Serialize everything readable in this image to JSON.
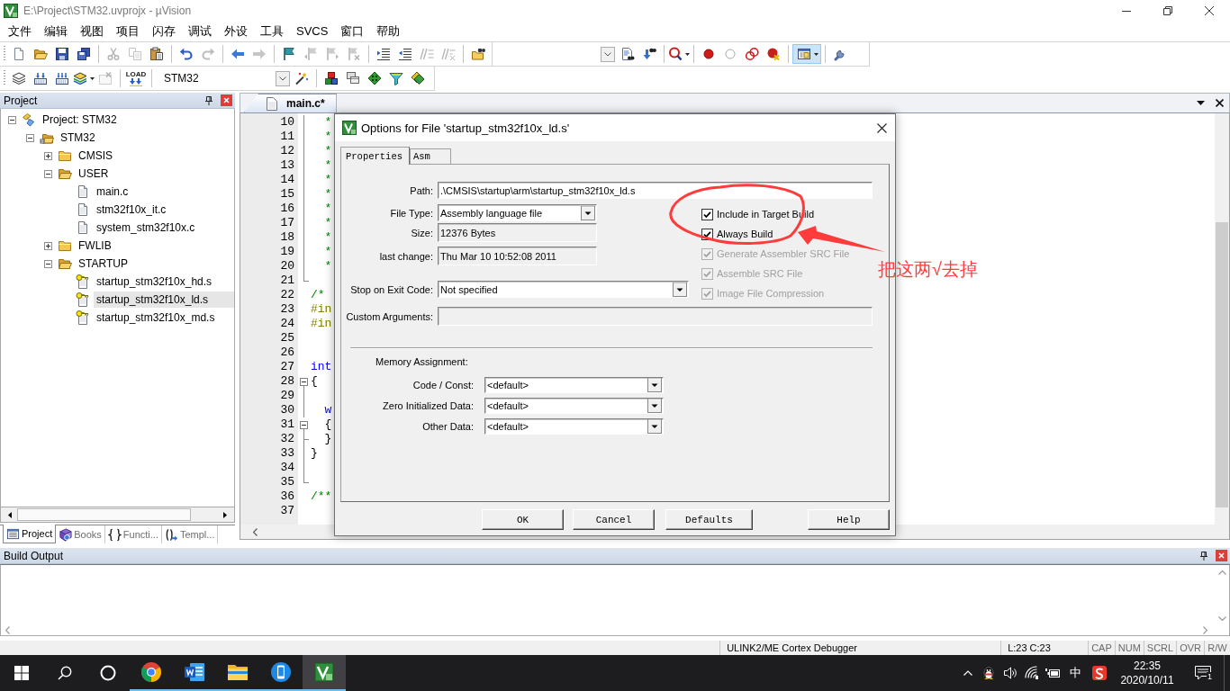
{
  "window": {
    "title": "E:\\Project\\STM32.uvprojx - µVision"
  },
  "menu": [
    "文件",
    "编辑",
    "视图",
    "项目",
    "闪存",
    "调试",
    "外设",
    "工具",
    "SVCS",
    "窗口",
    "帮助"
  ],
  "edit_toolbar": {
    "groups": [
      [
        {
          "kind": "new-file",
          "disabled": false
        },
        {
          "kind": "open",
          "disabled": false
        },
        {
          "kind": "save",
          "disabled": false
        },
        {
          "kind": "save-all",
          "disabled": false
        }
      ],
      [
        {
          "kind": "cut",
          "disabled": true
        },
        {
          "kind": "copy",
          "disabled": true
        },
        {
          "kind": "paste",
          "disabled": false
        }
      ],
      [
        {
          "kind": "undo",
          "disabled": false
        },
        {
          "kind": "redo",
          "disabled": true
        }
      ],
      [
        {
          "kind": "back",
          "disabled": false
        },
        {
          "kind": "forward",
          "disabled": true
        }
      ],
      [
        {
          "kind": "bookmark",
          "disabled": false
        },
        {
          "kind": "bookmark-prev",
          "disabled": true
        },
        {
          "kind": "bookmark-next",
          "disabled": true
        },
        {
          "kind": "bookmark-clear",
          "disabled": true
        }
      ],
      [
        {
          "kind": "indent",
          "disabled": false
        },
        {
          "kind": "unindent",
          "disabled": false
        },
        {
          "kind": "comment",
          "disabled": true
        },
        {
          "kind": "uncomment",
          "disabled": true
        }
      ],
      [
        {
          "kind": "find-files",
          "disabled": false
        }
      ]
    ]
  },
  "find_toolbar": {
    "groups": [
      [
        {
          "kind": "find-doc",
          "disabled": false
        },
        {
          "kind": "find-incremental",
          "disabled": false
        }
      ],
      [
        {
          "kind": "debug",
          "disabled": false,
          "menu": true
        }
      ],
      [
        {
          "kind": "breakpoint",
          "disabled": false
        },
        {
          "kind": "breakpoint-off",
          "disabled": false
        },
        {
          "kind": "breakpoint-toggle",
          "disabled": false
        },
        {
          "kind": "breakpoint-kill",
          "disabled": false
        }
      ],
      [
        {
          "kind": "window-layout",
          "disabled": false,
          "menu": true,
          "pressed": true
        }
      ],
      [
        {
          "kind": "configure",
          "disabled": false
        }
      ]
    ]
  },
  "build_toolbar": {
    "groups": [
      [
        {
          "kind": "translate",
          "disabled": false,
          "menu": false
        },
        {
          "kind": "build",
          "disabled": false,
          "menu": false
        },
        {
          "kind": "rebuild",
          "disabled": false,
          "menu": false
        },
        {
          "kind": "batch-build",
          "disabled": false,
          "menu": true
        },
        {
          "kind": "stop",
          "disabled": true,
          "menu": false
        }
      ],
      [
        {
          "kind": "download",
          "disabled": false,
          "label": "LOAD"
        }
      ]
    ],
    "target": "STM32",
    "target_groups": [
      [
        {
          "kind": "target-options",
          "disabled": false
        }
      ],
      [
        {
          "kind": "components",
          "disabled": false
        },
        {
          "kind": "windows",
          "disabled": false
        },
        {
          "kind": "diamond",
          "disabled": false
        },
        {
          "kind": "funnel",
          "disabled": false
        },
        {
          "kind": "diamonds",
          "disabled": false
        }
      ]
    ]
  },
  "project_panel": {
    "title": "Project",
    "tree": [
      {
        "label": "Project: STM32",
        "kind": "project",
        "expanded": true,
        "selected": false,
        "children": [
          {
            "label": "STM32",
            "kind": "target",
            "expanded": true,
            "selected": false,
            "children": [
              {
                "label": "CMSIS",
                "kind": "group",
                "expanded": false,
                "selected": false
              },
              {
                "label": "USER",
                "kind": "group",
                "expanded": true,
                "selected": false,
                "children": [
                  {
                    "label": "main.c",
                    "kind": "file",
                    "has_options": false,
                    "selected": false
                  },
                  {
                    "label": "stm32f10x_it.c",
                    "kind": "file",
                    "has_options": false,
                    "selected": false
                  },
                  {
                    "label": "system_stm32f10x.c",
                    "kind": "file",
                    "has_options": false,
                    "selected": false
                  }
                ]
              },
              {
                "label": "FWLIB",
                "kind": "group",
                "expanded": false,
                "selected": false
              },
              {
                "label": "STARTUP",
                "kind": "group",
                "expanded": true,
                "selected": false,
                "children": [
                  {
                    "label": "startup_stm32f10x_hd.s",
                    "kind": "file",
                    "has_options": true,
                    "selected": false
                  },
                  {
                    "label": "startup_stm32f10x_ld.s",
                    "kind": "file",
                    "has_options": true,
                    "selected": true
                  },
                  {
                    "label": "startup_stm32f10x_md.s",
                    "kind": "file",
                    "has_options": true,
                    "selected": false
                  }
                ]
              }
            ]
          }
        ]
      }
    ],
    "tabs": [
      {
        "label": "Project",
        "kind": "project",
        "selected": true
      },
      {
        "label": "Books",
        "kind": "books",
        "selected": false
      },
      {
        "label": "Functi...",
        "kind": "functions",
        "selected": false
      },
      {
        "label": "Templ...",
        "kind": "templates",
        "selected": false
      }
    ]
  },
  "editor": {
    "tabs": [
      {
        "label": "main.c*",
        "selected": true
      }
    ],
    "lines": [
      {
        "number": "10",
        "kind": "comment",
        "text": "  *",
        "fold": {
          "kind": "line"
        }
      },
      {
        "number": "11",
        "kind": "comment",
        "text": "  *",
        "fold": {
          "kind": "line"
        }
      },
      {
        "number": "12",
        "kind": "comment",
        "text": "  *",
        "fold": {
          "kind": "line"
        }
      },
      {
        "number": "13",
        "kind": "comment",
        "text": "  *",
        "fold": {
          "kind": "line"
        }
      },
      {
        "number": "14",
        "kind": "comment",
        "text": "  *",
        "fold": {
          "kind": "line"
        }
      },
      {
        "number": "15",
        "kind": "comment",
        "text": "  *",
        "fold": {
          "kind": "line"
        }
      },
      {
        "number": "16",
        "kind": "comment",
        "text": "  *",
        "fold": {
          "kind": "line"
        }
      },
      {
        "number": "17",
        "kind": "comment",
        "text": "  *",
        "fold": {
          "kind": "line"
        }
      },
      {
        "number": "18",
        "kind": "comment",
        "text": "  *",
        "fold": {
          "kind": "line"
        }
      },
      {
        "number": "19",
        "kind": "comment",
        "text": "  *",
        "fold": {
          "kind": "line"
        }
      },
      {
        "number": "20",
        "kind": "comment",
        "text": "  *",
        "fold": {
          "kind": "line"
        }
      },
      {
        "number": "21",
        "fold": {
          "kind": "end"
        }
      },
      {
        "number": "22",
        "kind": "comment",
        "text": "/*"
      },
      {
        "number": "23",
        "kind": "preprocessor",
        "text": "#in"
      },
      {
        "number": "24",
        "kind": "preprocessor",
        "text": "#in"
      },
      {
        "number": "25"
      },
      {
        "number": "26"
      },
      {
        "number": "27",
        "kind": "keyword",
        "text": "int"
      },
      {
        "number": "28",
        "kind": "plain",
        "text": "{",
        "fold": {
          "kind": "box",
          "expanded": true
        }
      },
      {
        "number": "29",
        "fold": {
          "kind": "line"
        }
      },
      {
        "number": "30",
        "kind": "keyword",
        "text": "  w",
        "fold": {
          "kind": "line"
        }
      },
      {
        "number": "31",
        "kind": "plain",
        "text": "  {",
        "fold": {
          "kind": "box",
          "expanded": true
        }
      },
      {
        "number": "32",
        "kind": "plain",
        "text": "  }",
        "fold": {
          "kind": "branch"
        }
      },
      {
        "number": "33",
        "kind": "plain",
        "text": "}",
        "fold": {
          "kind": "line"
        }
      },
      {
        "number": "34",
        "fold": {
          "kind": "line"
        }
      },
      {
        "number": "35",
        "fold": {
          "kind": "end"
        }
      },
      {
        "number": "36",
        "kind": "comment",
        "text": "/**"
      },
      {
        "number": "37"
      }
    ]
  },
  "dialog": {
    "title": "Options for File 'startup_stm32f10x_ld.s'",
    "tabs": [
      {
        "label": "Properties",
        "selected": true
      },
      {
        "label": "Asm",
        "selected": false
      }
    ],
    "path": {
      "label": "Path:",
      "value": ".\\CMSIS\\startup\\arm\\startup_stm32f10x_ld.s"
    },
    "fields": [
      {
        "label": "File Type:",
        "kind": "dropdown",
        "value": "Assembly language file"
      },
      {
        "label": "Size:",
        "kind": "readonly",
        "value": "12376 Bytes"
      },
      {
        "label": "last change:",
        "kind": "readonly",
        "value": "Thu Mar 10 10:52:08 2011"
      },
      {
        "label": "Stop on Exit Code:",
        "kind": "dropdown",
        "value": "Not specified"
      }
    ],
    "options": [
      {
        "label": "Include in Target Build",
        "checked": true,
        "disabled": false
      },
      {
        "label": "Always Build",
        "checked": true,
        "disabled": false
      },
      {
        "label": "Generate Assembler SRC File",
        "checked": true,
        "disabled": true
      },
      {
        "label": "Assemble SRC File",
        "checked": true,
        "disabled": true
      },
      {
        "label": "Image File Compression",
        "checked": true,
        "disabled": true
      }
    ],
    "custom_arguments": {
      "label": "Custom Arguments:",
      "disabled": true
    },
    "memory": {
      "title": "Memory Assignment:",
      "fields": [
        {
          "label": "Code / Const:",
          "value": "<default>"
        },
        {
          "label": "Zero Initialized Data:",
          "value": "<default>"
        },
        {
          "label": "Other Data:",
          "value": "<default>"
        }
      ]
    },
    "buttons": [
      "OK",
      "Cancel",
      "Defaults",
      "Help"
    ]
  },
  "annotation": {
    "note": "把这两√去掉"
  },
  "build_output": {
    "title": "Build Output"
  },
  "status_bar": {
    "debugger": "ULINK2/ME Cortex Debugger",
    "position": "L:23 C:23",
    "indicators": [
      {
        "label": "CAP",
        "on": false
      },
      {
        "label": "NUM",
        "on": false
      },
      {
        "label": "SCRL",
        "on": false
      },
      {
        "label": "OVR",
        "on": false
      },
      {
        "label": "R/W",
        "on": false
      }
    ]
  },
  "taskbar": {
    "apps": [
      {
        "kind": "browser",
        "running": true,
        "active": false
      },
      {
        "kind": "word",
        "running": true,
        "active": false
      },
      {
        "kind": "files",
        "running": true,
        "active": false
      },
      {
        "kind": "phone",
        "running": true,
        "active": false
      },
      {
        "kind": "ide",
        "running": true,
        "active": true
      }
    ],
    "ime": "中",
    "time": "22:35",
    "date": "2020/10/11",
    "notifications": "1"
  }
}
